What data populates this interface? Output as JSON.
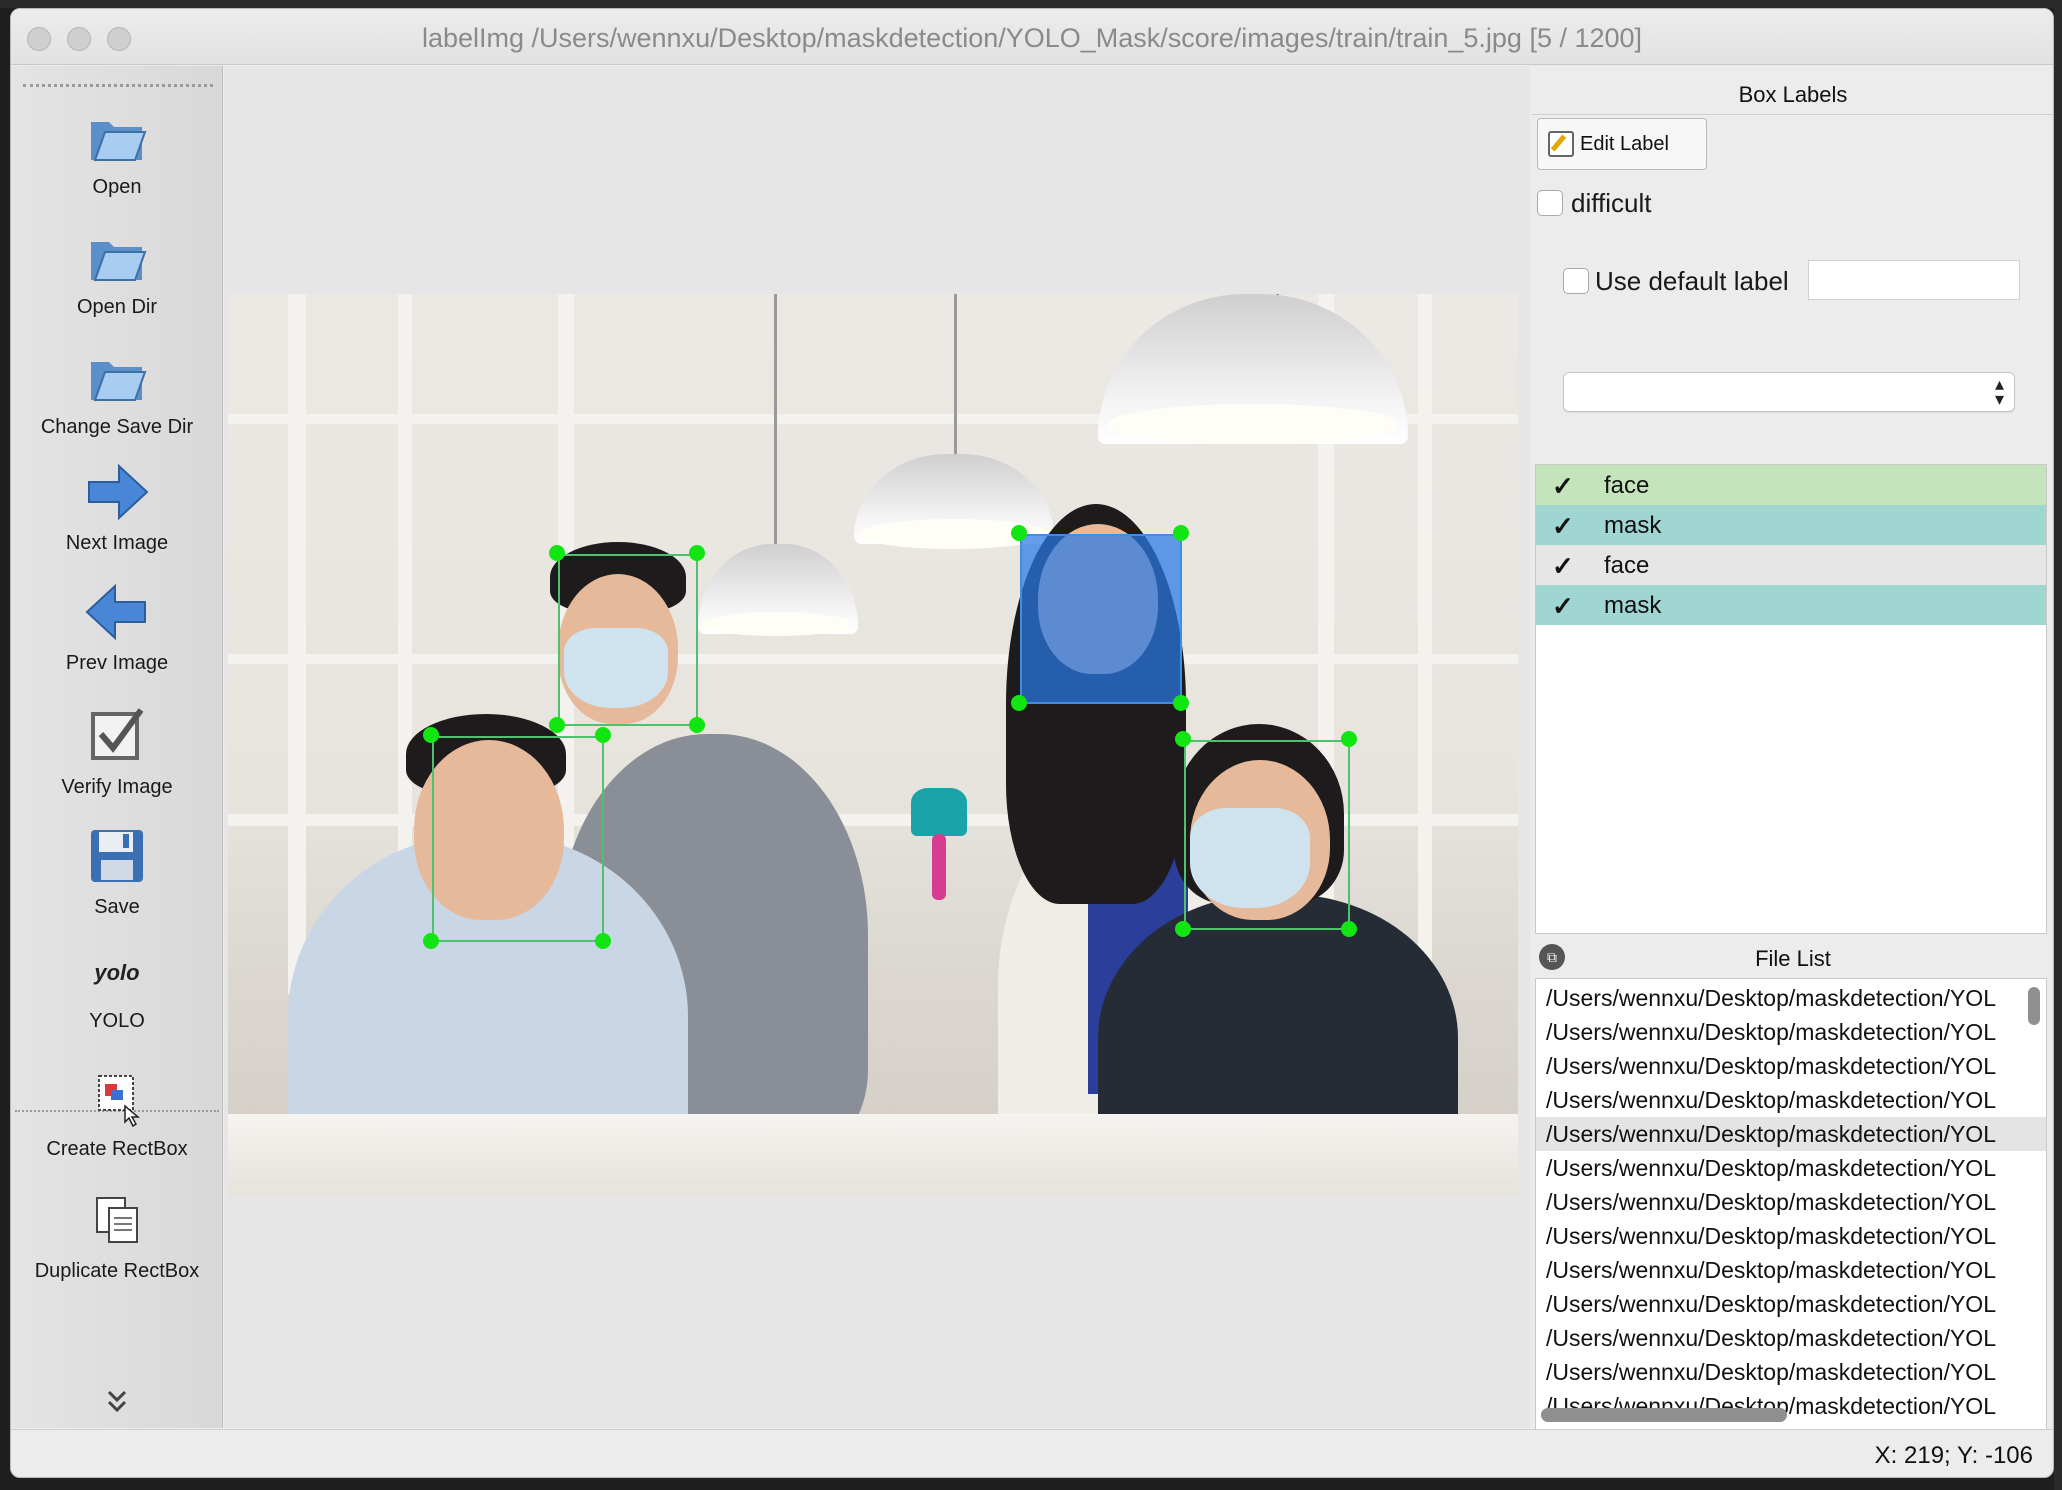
{
  "window": {
    "title": "labelImg /Users/wennxu/Desktop/maskdetection/YOLO_Mask/score/images/train/train_5.jpg [5 / 1200]"
  },
  "toolbar": {
    "open": "Open",
    "open_dir": "Open Dir",
    "change_save_dir": "Change Save Dir",
    "next_image": "Next Image",
    "prev_image": "Prev Image",
    "verify_image": "Verify Image",
    "save": "Save",
    "format_icon_text": "yolo",
    "format_label": "YOLO",
    "create_rectbox": "Create RectBox",
    "duplicate_rectbox": "Duplicate RectBox",
    "more_icon": "chevron-double-down-icon"
  },
  "box_labels": {
    "dock_title": "Box Labels",
    "edit_label_button": "Edit Label",
    "difficult_label": "difficult",
    "difficult_checked": false,
    "use_default_label": "Use default label",
    "use_default_checked": false,
    "default_label_value": "",
    "combo_value": "",
    "labels": [
      {
        "name": "face",
        "checked": true,
        "color": "#c4e4bb"
      },
      {
        "name": "mask",
        "checked": true,
        "color": "#9fd6d1"
      },
      {
        "name": "face",
        "checked": true,
        "color": "#e6e6e6"
      },
      {
        "name": "mask",
        "checked": true,
        "color": "#9fd6d1"
      }
    ],
    "check_glyph": "✓"
  },
  "file_list": {
    "dock_title": "File List",
    "current_index": 4,
    "items": [
      "/Users/wennxu/Desktop/maskdetection/YOL",
      "/Users/wennxu/Desktop/maskdetection/YOL",
      "/Users/wennxu/Desktop/maskdetection/YOL",
      "/Users/wennxu/Desktop/maskdetection/YOL",
      "/Users/wennxu/Desktop/maskdetection/YOL",
      "/Users/wennxu/Desktop/maskdetection/YOL",
      "/Users/wennxu/Desktop/maskdetection/YOL",
      "/Users/wennxu/Desktop/maskdetection/YOL",
      "/Users/wennxu/Desktop/maskdetection/YOL",
      "/Users/wennxu/Desktop/maskdetection/YOL",
      "/Users/wennxu/Desktop/maskdetection/YOL",
      "/Users/wennxu/Desktop/maskdetection/YOL",
      "/Users/wennxu/Desktop/maskdetection/YOL"
    ]
  },
  "status": {
    "coords": "X: 219; Y: -106"
  },
  "colors": {
    "box_border": "#4fc06d",
    "handle": "#12e612",
    "selected_fill": "#2878e6"
  }
}
